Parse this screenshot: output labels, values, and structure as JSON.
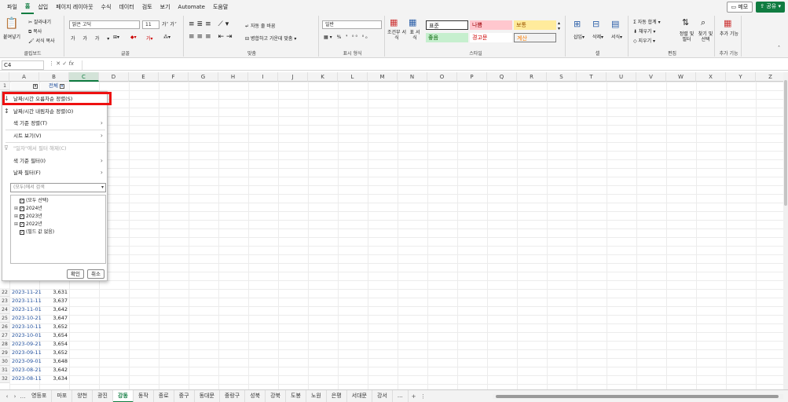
{
  "menu": {
    "tabs": [
      "파일",
      "홈",
      "삽입",
      "페이지 레이아웃",
      "수식",
      "데이터",
      "검토",
      "보기",
      "Automate",
      "도움말"
    ],
    "active_tab": "홈",
    "memo": "메모",
    "share": "공유"
  },
  "ribbon": {
    "clipboard": {
      "paste": "붙여넣기",
      "cut": "잘라내기",
      "copy": "복사",
      "format_painter": "서식 복사",
      "label": "클립보드"
    },
    "font": {
      "name": "맑은 고딕",
      "size": "11",
      "label": "글꼴"
    },
    "alignment": {
      "wrap": "자동 줄 바꿈",
      "merge": "병합하고 가운데 맞춤",
      "label": "맞춤"
    },
    "number": {
      "format": "일반",
      "label": "표시 형식"
    },
    "styles": {
      "conditional": "조건부 서식",
      "table": "표 서식",
      "normal": "표준",
      "bad": "나쁨",
      "neutral": "보통",
      "good": "좋음",
      "warning": "경고문",
      "calc": "계산",
      "label": "스타일"
    },
    "cells": {
      "insert": "삽입",
      "delete": "삭제",
      "format": "서식",
      "label": "셀"
    },
    "editing": {
      "autosum": "자동 합계",
      "fill": "채우기",
      "clear": "지우기",
      "sort": "정렬 및 필터",
      "find": "찾기 및 선택",
      "label": "편집"
    },
    "addins": {
      "btn": "추가 기능",
      "label": "추가 기능"
    }
  },
  "formula_bar": {
    "name_box": "C4",
    "fx": "fx"
  },
  "columns": [
    "A",
    "B",
    "C",
    "D",
    "E",
    "F",
    "G",
    "H",
    "I",
    "J",
    "K",
    "L",
    "M",
    "N",
    "O",
    "P",
    "Q",
    "R",
    "S",
    "T",
    "U",
    "V",
    "W",
    "X",
    "Y",
    "Z"
  ],
  "header_b": "전체",
  "rows": [
    {
      "num": "22",
      "date": "2023-11-21",
      "value": "3,631"
    },
    {
      "num": "23",
      "date": "2023-11-11",
      "value": "3,637"
    },
    {
      "num": "24",
      "date": "2023-11-01",
      "value": "3,642"
    },
    {
      "num": "25",
      "date": "2023-10-21",
      "value": "3,647"
    },
    {
      "num": "26",
      "date": "2023-10-11",
      "value": "3,652"
    },
    {
      "num": "27",
      "date": "2023-10-01",
      "value": "3,654"
    },
    {
      "num": "28",
      "date": "2023-09-21",
      "value": "3,654"
    },
    {
      "num": "29",
      "date": "2023-09-11",
      "value": "3,652"
    },
    {
      "num": "30",
      "date": "2023-09-01",
      "value": "3,648"
    },
    {
      "num": "31",
      "date": "2023-08-21",
      "value": "3,642"
    },
    {
      "num": "32",
      "date": "2023-08-11",
      "value": "3,634"
    }
  ],
  "filter_menu": {
    "sort_asc": "날짜/시간 오름차순 정렬(S)",
    "sort_desc": "날짜/시간 내림차순 정렬(O)",
    "sort_color": "색 기준 정렬(T)",
    "sheet_view": "시트 보기(V)",
    "clear_filter": "\"일자\"에서 필터 해제(C)",
    "filter_color": "색 기준 필터(I)",
    "date_filter": "날짜 필터(F)",
    "search_placeholder": "(모두)에서 검색",
    "tree": [
      "(모두 선택)",
      "2024년",
      "2023년",
      "2022년",
      "(필드 값 없음)"
    ],
    "ok": "확인",
    "cancel": "취소"
  },
  "sheets": [
    "영등포",
    "마포",
    "양천",
    "광진",
    "강동",
    "동작",
    "종로",
    "중구",
    "동대문",
    "중랑구",
    "성북",
    "강북",
    "도봉",
    "노원",
    "은평",
    "서대문",
    "강서",
    "..."
  ],
  "active_sheet": "강동"
}
